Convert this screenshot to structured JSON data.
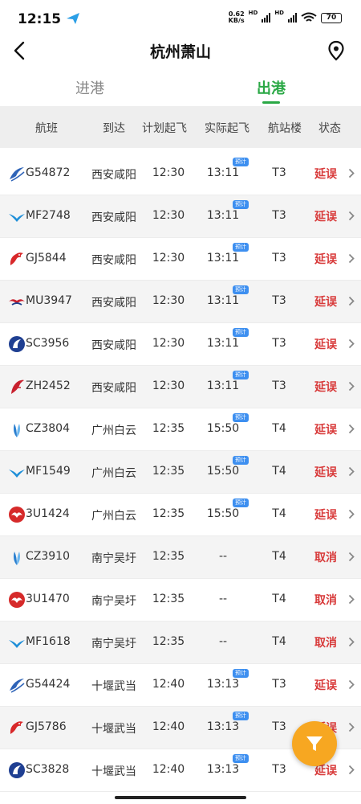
{
  "status_bar": {
    "time": "12:15",
    "speed_value": "0.62",
    "speed_unit": "KB/s",
    "hd1": "HD",
    "hd2": "HD",
    "battery": "70"
  },
  "header": {
    "title": "杭州萧山"
  },
  "tabs": {
    "arrivals": "进港",
    "departures": "出港",
    "active": "departures"
  },
  "columns": {
    "flight": "航班",
    "dest": "到达",
    "planned": "计划起飞",
    "actual": "实际起飞",
    "terminal": "航站楼",
    "status": "状态"
  },
  "est_badge": "预计",
  "colors": {
    "accent": "#2aa845",
    "delay": "#d83a3a",
    "badge": "#3d8ff0",
    "fab": "#f7a721"
  },
  "flights": [
    {
      "no": "G54872",
      "dest": "西安咸阳",
      "plan": "12:30",
      "actual": "13:11",
      "estimated": true,
      "terminal": "T3",
      "status": "延误",
      "airline_icon": "huaxia-airlines-logo"
    },
    {
      "no": "MF2748",
      "dest": "西安咸阳",
      "plan": "12:30",
      "actual": "13:11",
      "estimated": true,
      "terminal": "T3",
      "status": "延误",
      "airline_icon": "xiamen-airlines-logo"
    },
    {
      "no": "GJ5844",
      "dest": "西安咸阳",
      "plan": "12:30",
      "actual": "13:11",
      "estimated": true,
      "terminal": "T3",
      "status": "延误",
      "airline_icon": "loong-air-logo"
    },
    {
      "no": "MU3947",
      "dest": "西安咸阳",
      "plan": "12:30",
      "actual": "13:11",
      "estimated": true,
      "terminal": "T3",
      "status": "延误",
      "airline_icon": "china-eastern-logo"
    },
    {
      "no": "SC3956",
      "dest": "西安咸阳",
      "plan": "12:30",
      "actual": "13:11",
      "estimated": true,
      "terminal": "T3",
      "status": "延误",
      "airline_icon": "shandong-airlines-logo"
    },
    {
      "no": "ZH2452",
      "dest": "西安咸阳",
      "plan": "12:30",
      "actual": "13:11",
      "estimated": true,
      "terminal": "T3",
      "status": "延误",
      "airline_icon": "shenzhen-airlines-logo"
    },
    {
      "no": "CZ3804",
      "dest": "广州白云",
      "plan": "12:35",
      "actual": "15:50",
      "estimated": true,
      "terminal": "T4",
      "status": "延误",
      "airline_icon": "china-southern-logo"
    },
    {
      "no": "MF1549",
      "dest": "广州白云",
      "plan": "12:35",
      "actual": "15:50",
      "estimated": true,
      "terminal": "T4",
      "status": "延误",
      "airline_icon": "xiamen-airlines-logo"
    },
    {
      "no": "3U1424",
      "dest": "广州白云",
      "plan": "12:35",
      "actual": "15:50",
      "estimated": true,
      "terminal": "T4",
      "status": "延误",
      "airline_icon": "sichuan-airlines-logo"
    },
    {
      "no": "CZ3910",
      "dest": "南宁吴圩",
      "plan": "12:35",
      "actual": "--",
      "estimated": false,
      "terminal": "T4",
      "status": "取消",
      "airline_icon": "china-southern-logo"
    },
    {
      "no": "3U1470",
      "dest": "南宁吴圩",
      "plan": "12:35",
      "actual": "--",
      "estimated": false,
      "terminal": "T4",
      "status": "取消",
      "airline_icon": "sichuan-airlines-logo"
    },
    {
      "no": "MF1618",
      "dest": "南宁吴圩",
      "plan": "12:35",
      "actual": "--",
      "estimated": false,
      "terminal": "T4",
      "status": "取消",
      "airline_icon": "xiamen-airlines-logo"
    },
    {
      "no": "G54424",
      "dest": "十堰武当",
      "plan": "12:40",
      "actual": "13:13",
      "estimated": true,
      "terminal": "T3",
      "status": "延误",
      "airline_icon": "huaxia-airlines-logo"
    },
    {
      "no": "GJ5786",
      "dest": "十堰武当",
      "plan": "12:40",
      "actual": "13:13",
      "estimated": true,
      "terminal": "T3",
      "status": "延误",
      "airline_icon": "loong-air-logo"
    },
    {
      "no": "SC3828",
      "dest": "十堰武当",
      "plan": "12:40",
      "actual": "13:13",
      "estimated": true,
      "terminal": "T3",
      "status": "延误",
      "airline_icon": "shandong-airlines-logo"
    }
  ]
}
